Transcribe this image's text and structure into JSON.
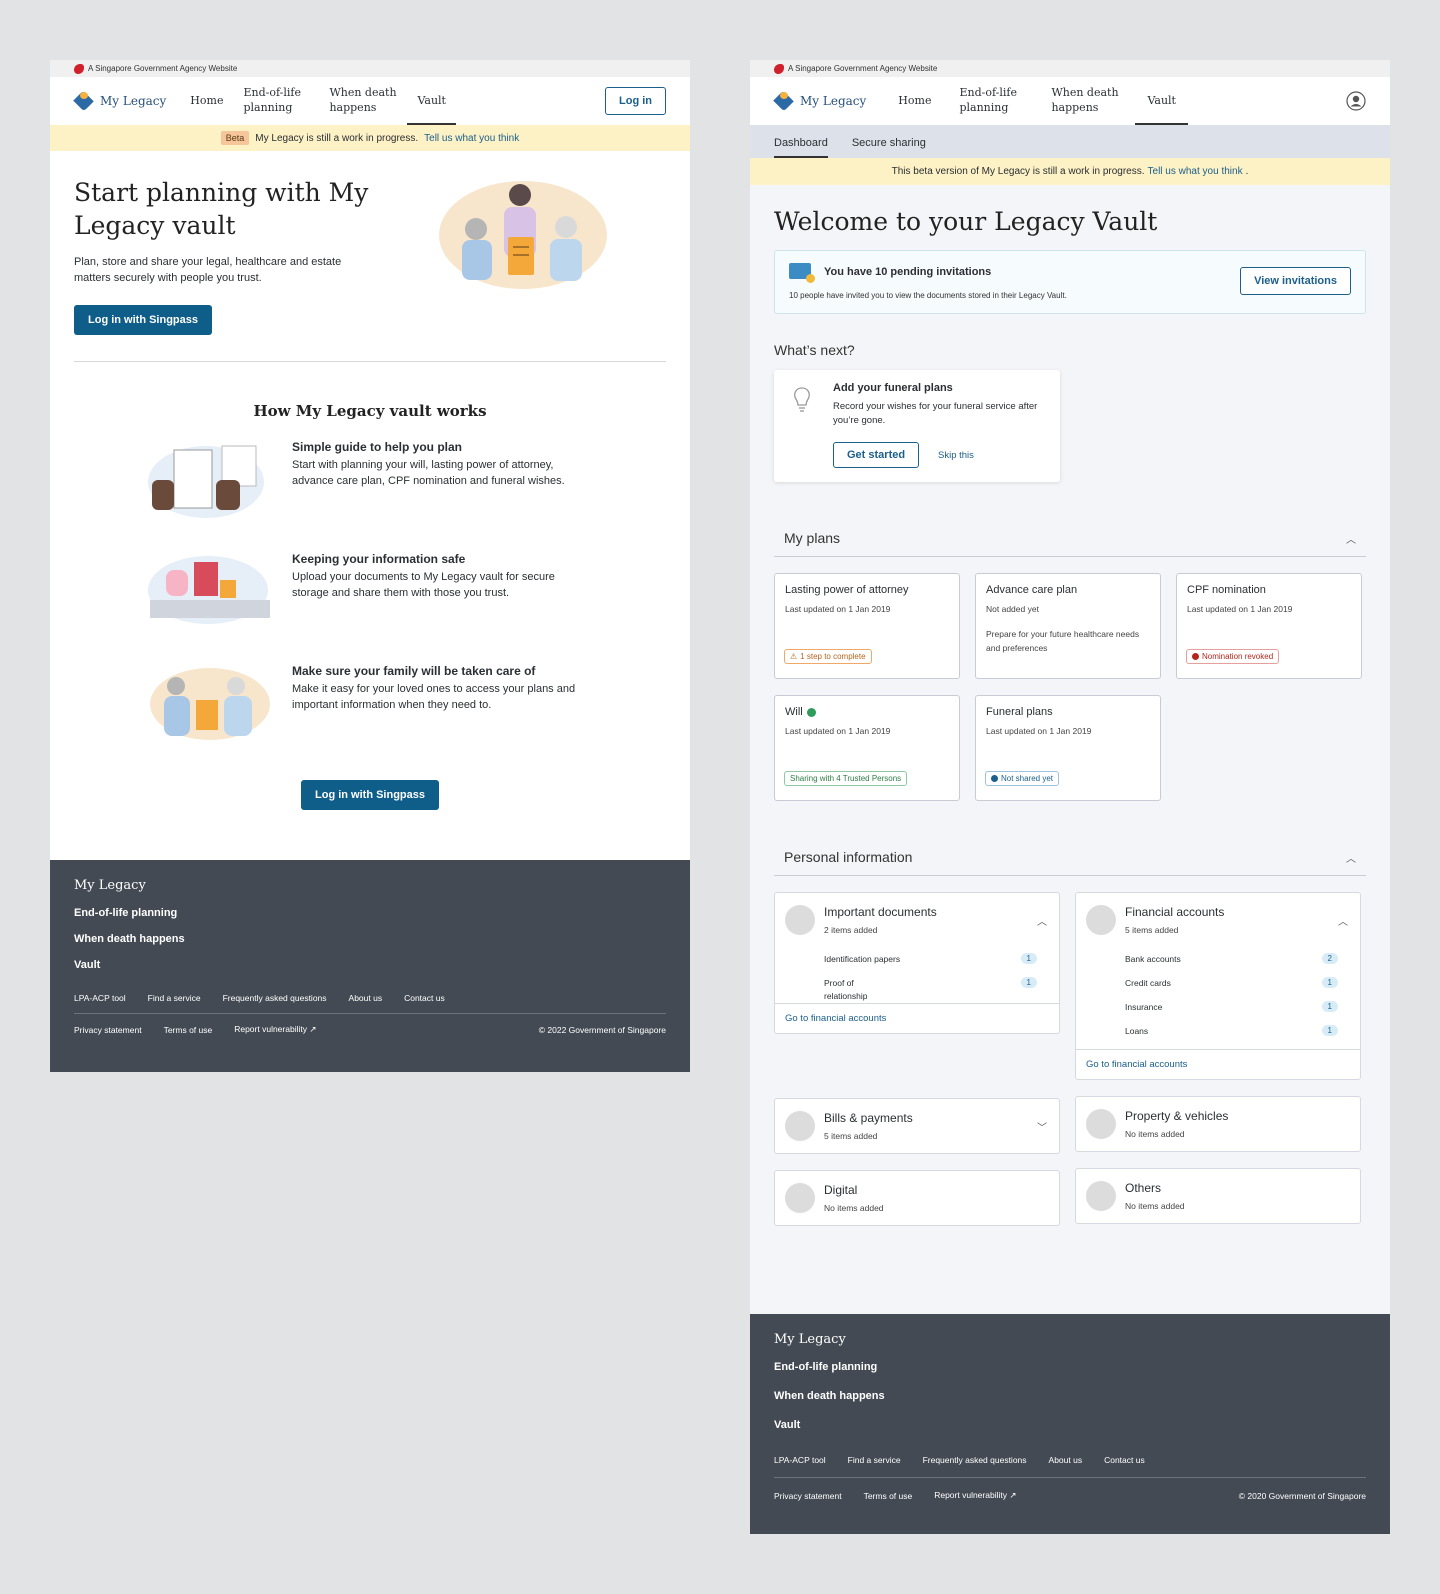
{
  "left": {
    "gov_banner": "A Singapore Government Agency Website",
    "brand": "My Legacy",
    "nav": [
      "Home",
      "End-of-life planning",
      "When death happens",
      "Vault"
    ],
    "login_btn": "Log in",
    "beta_tag": "Beta",
    "beta_text": "My Legacy is still a work in progress.",
    "beta_link": "Tell us what you think",
    "hero_title": "Start planning with My Legacy vault",
    "hero_desc": "Plan, store and share your legal, healthcare and estate matters securely with people you trust.",
    "singpass_btn": "Log in with Singpass",
    "how_title": "How My Legacy vault works",
    "how": [
      {
        "title": "Simple guide to help you plan",
        "desc": "Start with planning your will, lasting power of attorney, advance care plan, CPF nomination and funeral wishes."
      },
      {
        "title": "Keeping your information safe",
        "desc": "Upload your documents to My Legacy vault for secure storage and share them with those you trust."
      },
      {
        "title": "Make sure your family will be taken care of",
        "desc": "Make it easy for your loved ones to access your plans and important information when they need to."
      }
    ],
    "footer": {
      "brand": "My Legacy",
      "links": [
        "End-of-life planning",
        "When death happens",
        "Vault"
      ],
      "small": [
        "LPA-ACP tool",
        "Find a service",
        "Frequently asked questions",
        "About us",
        "Contact us"
      ],
      "bottom": [
        "Privacy statement",
        "Terms of use",
        "Report vulnerability"
      ],
      "copyright": "© 2022 Government of Singapore"
    }
  },
  "right": {
    "gov_banner": "A Singapore Government Agency Website",
    "brand": "My Legacy",
    "nav": [
      "Home",
      "End-of-life planning",
      "When death happens",
      "Vault"
    ],
    "subtabs": [
      "Dashboard",
      "Secure sharing"
    ],
    "beta_text": "This beta version of My Legacy is still a work in progress.",
    "beta_link": "Tell us what you think",
    "welcome": "Welcome to your Legacy Vault",
    "invite_title": "You have 10 pending invitations",
    "invite_sub": "10 people have invited you to view the documents stored in their Legacy Vault.",
    "invite_btn": "View invitations",
    "next_heading": "What’s next?",
    "next_title": "Add your funeral plans",
    "next_desc": "Record your wishes for your funeral service after you’re gone.",
    "next_btn": "Get started",
    "next_skip": "Skip this",
    "plans_heading": "My plans",
    "plans": [
      {
        "title": "Lasting power of attorney",
        "updated": "Last updated on 1 Jan 2019",
        "pill": "1 step to complete"
      },
      {
        "title": "Advance care plan",
        "updated": "Not added yet",
        "desc": "Prepare for your future healthcare needs and preferences"
      },
      {
        "title": "CPF nomination",
        "updated": "Last updated on 1 Jan 2019",
        "pill": "Nomination revoked"
      },
      {
        "title": "Will",
        "updated": "Last updated on 1 Jan 2019",
        "pill": "Sharing with 4 Trusted Persons"
      },
      {
        "title": "Funeral plans",
        "updated": "Last updated on 1 Jan 2019",
        "pill": "Not shared yet"
      }
    ],
    "personal_heading": "Personal information",
    "docs": {
      "title": "Important documents",
      "sub": "2 items added",
      "rows": [
        {
          "label": "Identification papers",
          "count": "1"
        },
        {
          "label": "Proof of relationship",
          "count": "1"
        }
      ],
      "link": "Go to financial accounts"
    },
    "fin": {
      "title": "Financial accounts",
      "sub": "5 items added",
      "rows": [
        {
          "label": "Bank accounts",
          "count": "2"
        },
        {
          "label": "Credit cards",
          "count": "1"
        },
        {
          "label": "Insurance",
          "count": "1"
        },
        {
          "label": "Loans",
          "count": "1"
        }
      ],
      "link": "Go to financial accounts"
    },
    "bills": {
      "title": "Bills & payments",
      "sub": "5 items added"
    },
    "property": {
      "title": "Property & vehicles",
      "sub": "No items added"
    },
    "digital": {
      "title": "Digital",
      "sub": "No items added"
    },
    "others": {
      "title": "Others",
      "sub": "No items added"
    },
    "footer": {
      "brand": "My Legacy",
      "links": [
        "End-of-life planning",
        "When death happens",
        "Vault"
      ],
      "small": [
        "LPA-ACP tool",
        "Find a service",
        "Frequently asked questions",
        "About us",
        "Contact us"
      ],
      "bottom": [
        "Privacy statement",
        "Terms of use",
        "Report vulnerability"
      ],
      "copyright": "© 2020 Government of Singapore"
    }
  },
  "colors": {
    "primary": "#0f5e8a",
    "footer": "#434a53",
    "beta": "#fdf1c6"
  }
}
